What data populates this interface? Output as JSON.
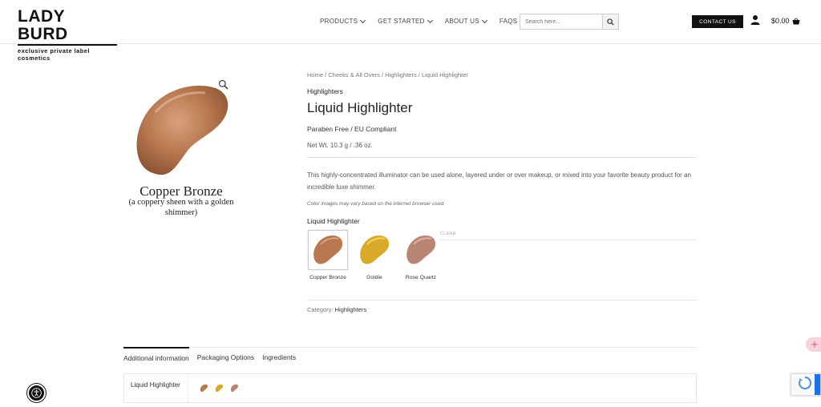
{
  "header": {
    "logo_title": "LADY BURD",
    "logo_tagline": "exclusive private label cosmetics",
    "nav": [
      {
        "label": "PRODUCTS",
        "has_dropdown": true
      },
      {
        "label": "GET STARTED",
        "has_dropdown": true
      },
      {
        "label": "ABOUT US",
        "has_dropdown": true
      },
      {
        "label": "FAQS",
        "has_dropdown": false
      }
    ],
    "search_placeholder": "Search here...",
    "contact_label": "CONTACT US",
    "cart_total": "$0.00"
  },
  "product_image": {
    "shade_title": "Copper Bronze",
    "shade_description": "(a coppery sheen with a golden shimmer)"
  },
  "product": {
    "breadcrumb": "Home / Cheeks & All Overs / Highlighters / Liquid Highlighter",
    "category_link": "Highlighters",
    "title": "Liquid Highlighter",
    "subtitle": "Paraben Free / EU Compliant",
    "net_weight": "Net Wt. 10.3 g / .36 oz.",
    "description": "This highly-concentrated illuminator can be used alone, layered under or over makeup, or mixed into your favorite beauty product for an incredible luxe shimmer.",
    "color_note": "Color images may vary based on the internet browser used.",
    "variant_label": "Liquid Highlighter",
    "clear_label": "CLEAR",
    "variants": [
      {
        "label": "Copper Bronze",
        "selected": true
      },
      {
        "label": "Goldie",
        "selected": false
      },
      {
        "label": "Rose Quartz",
        "selected": false
      }
    ],
    "category_meta_label": "Category:",
    "category_meta_value": "Highlighters"
  },
  "tabs": [
    {
      "label": "Additional information",
      "active": true
    },
    {
      "label": "Packaging Options",
      "active": false
    },
    {
      "label": "Ingredients",
      "active": false
    }
  ],
  "info_table": {
    "key": "Liquid Highlighter"
  },
  "colors": {
    "copper": "#b7774f",
    "gold": "#d9a92a",
    "rose": "#b98575",
    "button_dark": "#111111",
    "recaptcha_blue": "#1a73e8"
  }
}
